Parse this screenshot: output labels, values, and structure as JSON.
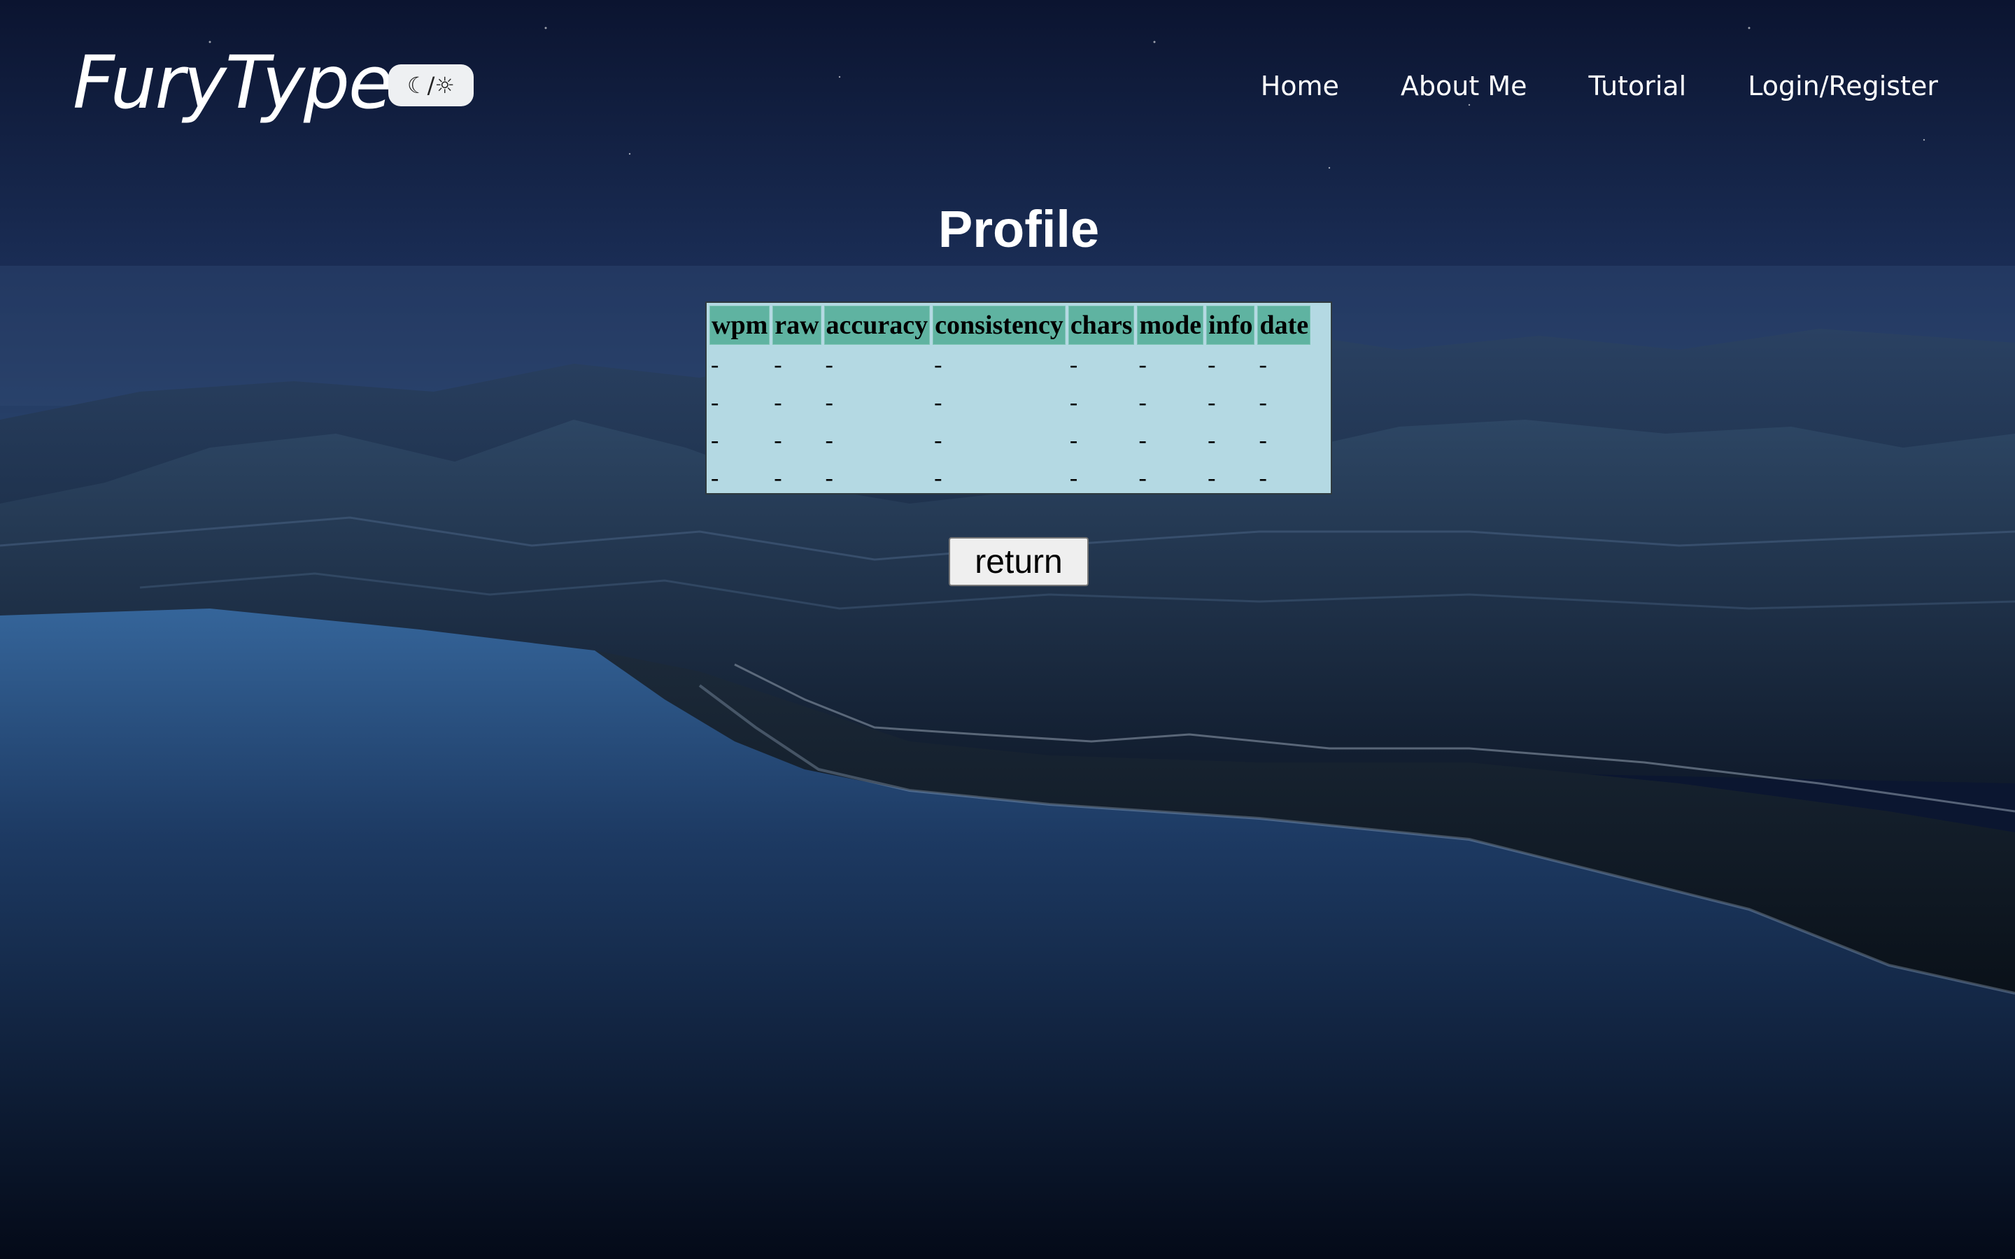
{
  "header": {
    "logo": "FuryType",
    "theme_toggle_label": "☾/☼",
    "nav": [
      {
        "label": "Home"
      },
      {
        "label": "About Me"
      },
      {
        "label": "Tutorial"
      },
      {
        "label": "Login/Register"
      }
    ]
  },
  "main": {
    "title": "Profile",
    "table": {
      "columns": [
        "wpm",
        "raw",
        "accuracy",
        "consistency",
        "chars",
        "mode",
        "info",
        "date"
      ],
      "rows": [
        [
          "-",
          "-",
          "-",
          "-",
          "-",
          "-",
          "-",
          "-"
        ],
        [
          "-",
          "-",
          "-",
          "-",
          "-",
          "-",
          "-",
          "-"
        ],
        [
          "-",
          "-",
          "-",
          "-",
          "-",
          "-",
          "-",
          "-"
        ],
        [
          "-",
          "-",
          "-",
          "-",
          "-",
          "-",
          "-",
          "-"
        ]
      ]
    },
    "return_label": "return"
  },
  "colors": {
    "table_background": "#b4d9e3",
    "table_header": "#5fb3a1",
    "text_on_dark": "#ffffff"
  }
}
